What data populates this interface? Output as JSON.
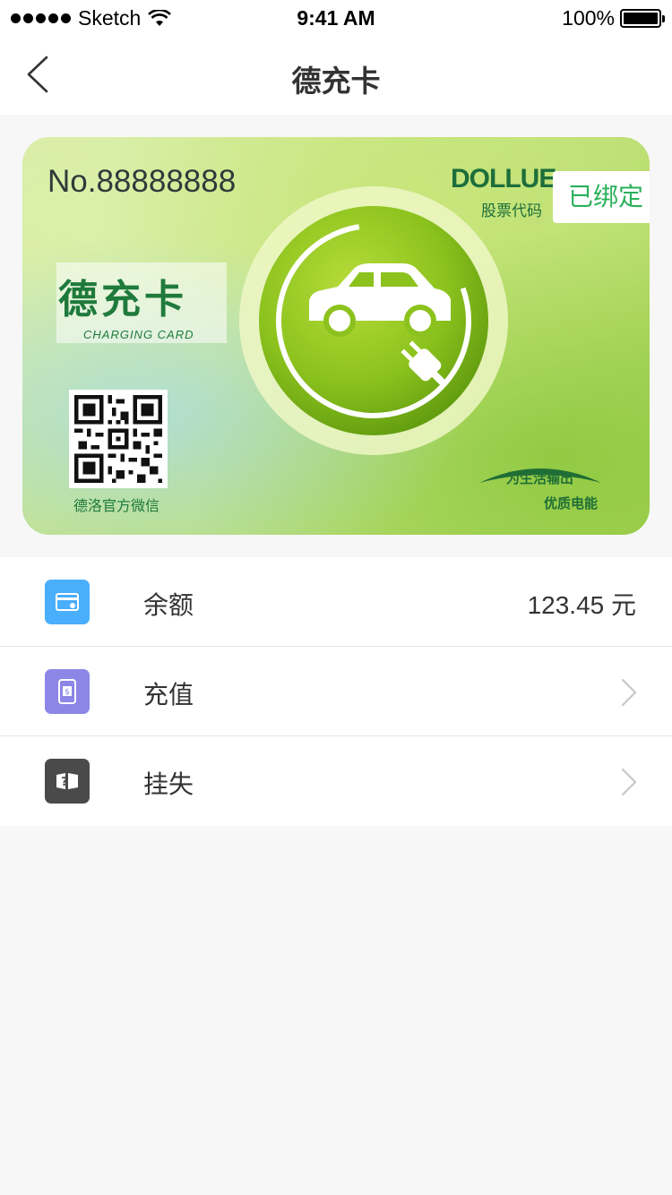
{
  "status_bar": {
    "carrier": "Sketch",
    "time": "9:41 AM",
    "battery": "100%"
  },
  "nav": {
    "title": "德充卡"
  },
  "card": {
    "number": "No.88888888",
    "brand": "DOLLUE",
    "brand_sub": "股票代码",
    "bound_badge": "已绑定",
    "name_cn": "德充卡",
    "name_en": "CHARGING CARD",
    "qr_caption": "德洛官方微信",
    "slogan_line1": "为生活输出",
    "slogan_line2": "优质电能"
  },
  "menu": {
    "items": [
      {
        "label": "余额",
        "value": "123.45 元",
        "icon": "card-balance-icon",
        "color": "#49aefc"
      },
      {
        "label": "充值",
        "icon": "recharge-phone-icon",
        "color": "#8c86e6"
      },
      {
        "label": "挂失",
        "icon": "report-loss-icon",
        "color": "#4a4a4a"
      }
    ]
  }
}
